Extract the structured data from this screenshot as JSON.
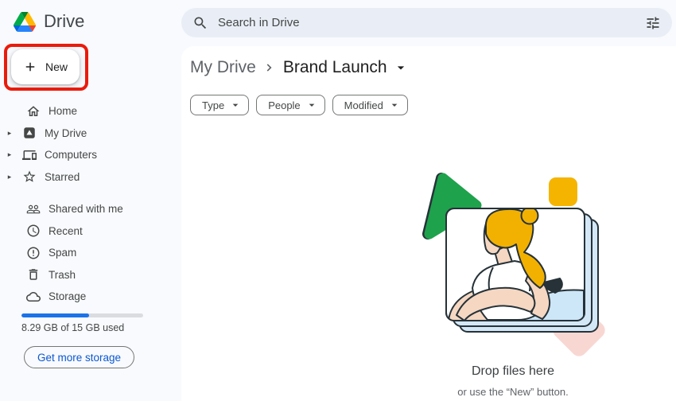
{
  "header": {
    "app_name": "Drive",
    "search": {
      "placeholder": "Search in Drive"
    }
  },
  "sidebar": {
    "new_button": {
      "label": "New"
    },
    "items": [
      {
        "label": "Home",
        "icon": "home-icon",
        "expandable": false
      },
      {
        "label": "My Drive",
        "icon": "my-drive-icon",
        "expandable": true
      },
      {
        "label": "Computers",
        "icon": "computers-icon",
        "expandable": true
      },
      {
        "label": "Starred",
        "icon": "star-icon",
        "expandable": true
      },
      {
        "label": "Shared with me",
        "icon": "shared-with-me-icon",
        "expandable": false
      },
      {
        "label": "Recent",
        "icon": "clock-icon",
        "expandable": false
      },
      {
        "label": "Spam",
        "icon": "spam-icon",
        "expandable": false
      },
      {
        "label": "Trash",
        "icon": "trash-icon",
        "expandable": false
      },
      {
        "label": "Storage",
        "icon": "cloud-icon",
        "expandable": false
      }
    ],
    "storage": {
      "used_text": "8.29 GB of 15 GB used",
      "percent_used": 55.3,
      "button_label": "Get more storage"
    }
  },
  "main": {
    "breadcrumb": {
      "parent": "My Drive",
      "current": "Brand Launch"
    },
    "filters": [
      {
        "label": "Type"
      },
      {
        "label": "People"
      },
      {
        "label": "Modified"
      }
    ],
    "empty_state": {
      "title": "Drop files here",
      "subtitle": "or use the “New” button."
    }
  },
  "annotation": {
    "type": "highlight-box",
    "target": "new-button",
    "color": "#EA1B0C"
  },
  "colors": {
    "page-bg": "#F8FAFD",
    "card-bg": "#FFFFFF",
    "search-bg": "#E9EEF6",
    "text-primary": "#1F1F1F",
    "text-secondary": "#5F6368",
    "sidebar-text": "#444746",
    "chip-border": "#747775",
    "accent-blue": "#1A73E8",
    "link-blue": "#0B57D0",
    "annotation-red": "#EA1B0C",
    "progress-track": "#DADCE0",
    "illus-green": "#1EA24C",
    "illus-yellow": "#F5B400",
    "illus-pink": "#F8D7D3",
    "illus-blue-card": "#D4E7F7",
    "illus-outline": "#263238",
    "illus-skin": "#F5D7C2",
    "illus-hair": "#F2B100",
    "illus-skirt": "#CDE6F8"
  }
}
